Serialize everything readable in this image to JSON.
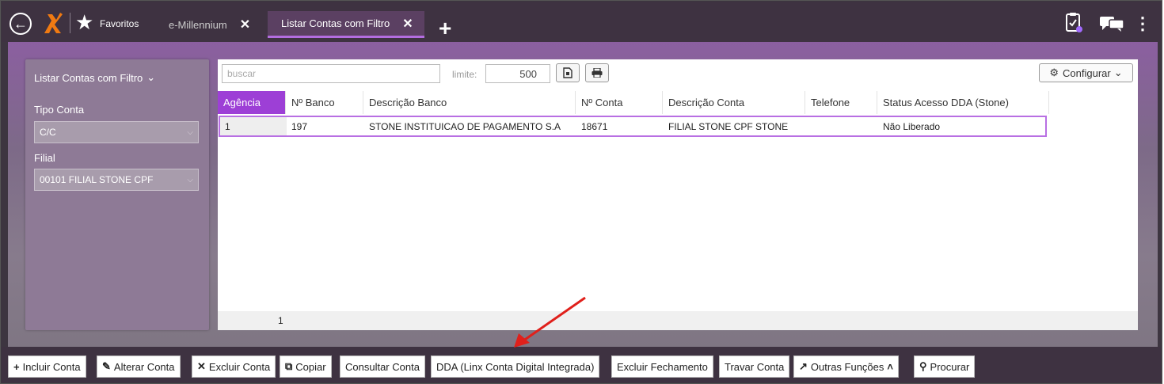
{
  "topbar": {
    "favorites_label": "Favoritos",
    "tabs": [
      {
        "label": "e-Millennium",
        "close": "✕"
      },
      {
        "label": "Listar Contas com Filtro",
        "close": "✕"
      }
    ],
    "add_tab": "+"
  },
  "filter": {
    "title": "Listar Contas com Filtro",
    "tipo_conta_label": "Tipo Conta",
    "tipo_conta_value": "C/C",
    "filial_label": "Filial",
    "filial_value": "00101 FILIAL STONE CPF"
  },
  "main": {
    "search_placeholder": "buscar",
    "limit_label": "limite:",
    "limit_value": "500",
    "config_label": "Configurar",
    "columns": [
      "Agência",
      "Nº Banco",
      "Descrição Banco",
      "Nº Conta",
      "Descrição Conta",
      "Telefone",
      "Status Acesso DDA (Stone)"
    ],
    "rows": [
      {
        "agencia": "1",
        "banco": "197",
        "descricao_banco": "STONE INSTITUICAO DE PAGAMENTO S.A",
        "conta": "18671",
        "descricao_conta": "FILIAL STONE CPF STONE",
        "telefone": "",
        "status": "Não Liberado"
      }
    ],
    "footer_count": "1"
  },
  "actions": {
    "incluir": "Incluir Conta",
    "alterar": "Alterar Conta",
    "excluir": "Excluir Conta",
    "copiar": "Copiar",
    "consultar": "Consultar Conta",
    "dda": "DDA (Linx Conta Digital Integrada)",
    "excluir_fechamento": "Excluir Fechamento",
    "travar": "Travar Conta",
    "outras": "Outras Funções",
    "procurar": "Procurar"
  },
  "colors": {
    "accent": "#9d3fd6",
    "topbar": "#3e3241",
    "arrow": "#e0201b"
  }
}
